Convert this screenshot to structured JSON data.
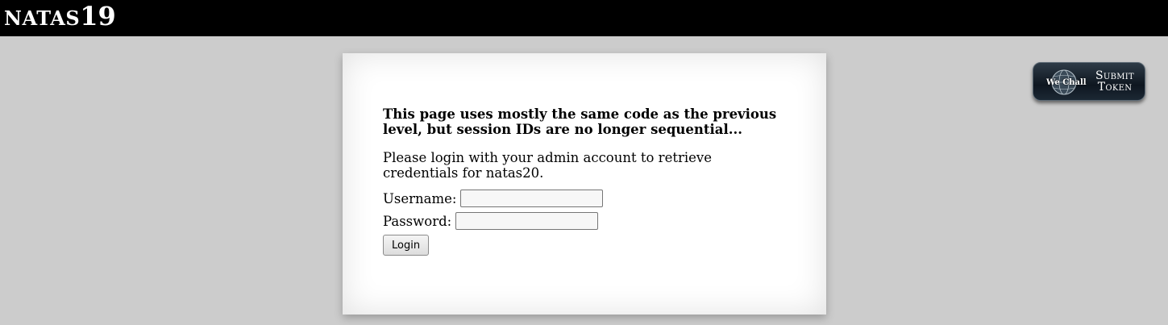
{
  "header": {
    "site_name": "NATAS",
    "level": "19"
  },
  "content": {
    "intro": "This page uses mostly the same code as the previous level, but session IDs are no longer sequential...",
    "instructions": "Please login with your admin account to retrieve credentials for natas20.",
    "username_label": "Username:",
    "username_value": "",
    "password_label": "Password:",
    "password_value": "",
    "login_label": "Login"
  },
  "submit_token": {
    "logo_text": "We Chall",
    "label_line1": "Submit",
    "label_line2": "Token"
  },
  "colors": {
    "page_background": "#cccccc",
    "header_background": "#000000",
    "content_background": "#ffffff"
  },
  "icons": [
    "wechall-globe-icon"
  ]
}
